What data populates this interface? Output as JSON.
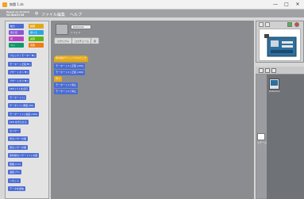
{
  "window": {
    "title": "無題 1.sb",
    "controls": [
      "—",
      "□",
      "✕"
    ]
  },
  "menubar": {
    "logo_line1": "Based on Scratch",
    "logo_line2": "SCRATCH",
    "items": [
      "ファイル",
      "編集",
      "ヘルプ"
    ]
  },
  "palette": {
    "categories": [
      {
        "label": "動き",
        "color": "#4a6cd4"
      },
      {
        "label": "制御",
        "color": "#e1a91a"
      },
      {
        "label": "見た目",
        "color": "#8a55d7"
      },
      {
        "label": "調べる",
        "color": "#2ca5e2"
      },
      {
        "label": "音",
        "color": "#bb42c3"
      },
      {
        "label": "演算",
        "color": "#5cb712"
      },
      {
        "label": "ペン",
        "color": "#0e9a6c"
      },
      {
        "label": "変数",
        "color": "#ee7d16"
      }
    ],
    "blocks": [
      {
        "text": "ブロック [ モーター ▼ ]",
        "color": "#4a6cd4"
      },
      {
        "text": "モーター [ 正転 ▼ ]",
        "color": "#4a6cd4"
      },
      {
        "text": "ブザー [ オン ▼ ]",
        "color": "#4a6cd4"
      },
      {
        "text": "ブザー [ オフ ▼ ]",
        "color": "#4a6cd4"
      },
      {
        "text": "LED [ 1 ] を点灯",
        "color": "#4a6cd4"
      },
      {
        "text": "モーター [ 1 ]",
        "color": "#4a6cd4"
      },
      {
        "text": "サーボ [ 1 ] 角度 (90)",
        "color": "#4a6cd4"
      },
      {
        "text": "モーター [ 1 ] 速度 (100)",
        "color": "#4a6cd4"
      },
      {
        "text": "LED を光らせる",
        "color": "#4a6cd4"
      },
      {
        "text": "センサー",
        "color": "#4a6cd4"
      },
      {
        "text": "光センサーの値",
        "color": "#4a6cd4"
      },
      {
        "text": "音センサーの値",
        "color": "#4a6cd4"
      },
      {
        "text": "赤外線センサー [ 1 ] の値",
        "color": "#4a6cd4"
      },
      {
        "text": "距離 (cm)",
        "color": "#4a6cd4"
      },
      {
        "text": "温度 (℃)",
        "color": "#4a6cd4"
      },
      {
        "text": "リセット",
        "color": "#4a6cd4"
      },
      {
        "text": "データを送信",
        "color": "#4a6cd4"
      }
    ]
  },
  "scripts": {
    "sprite_name": "Arduino1",
    "sprite_xy": "x: 0  y: 0",
    "tabs": [
      "スクリプト",
      "コスチューム",
      "音"
    ],
    "stack": [
      {
        "text": "緑の旗がクリックされたとき",
        "color": "#e1a91a"
      },
      {
        "text": "モーター [ 1 ] 正転 (100)",
        "color": "#4a6cd4"
      },
      {
        "text": "モーター [ 2 ] 正転 (100)",
        "color": "#4a6cd4"
      },
      {
        "text": "待つ",
        "color": "#e1a91a"
      },
      {
        "text": "モーター [ 1 ] 停止",
        "color": "#4a6cd4"
      },
      {
        "text": "モーター [ 2 ] 停止",
        "color": "#4a6cd4"
      }
    ]
  },
  "stage": {
    "label": "ステージ",
    "new_sprite_label": "新しいスプライト"
  },
  "sprites": {
    "items": [
      {
        "label": "Arduino1"
      }
    ],
    "stage_label": "ステージ"
  }
}
